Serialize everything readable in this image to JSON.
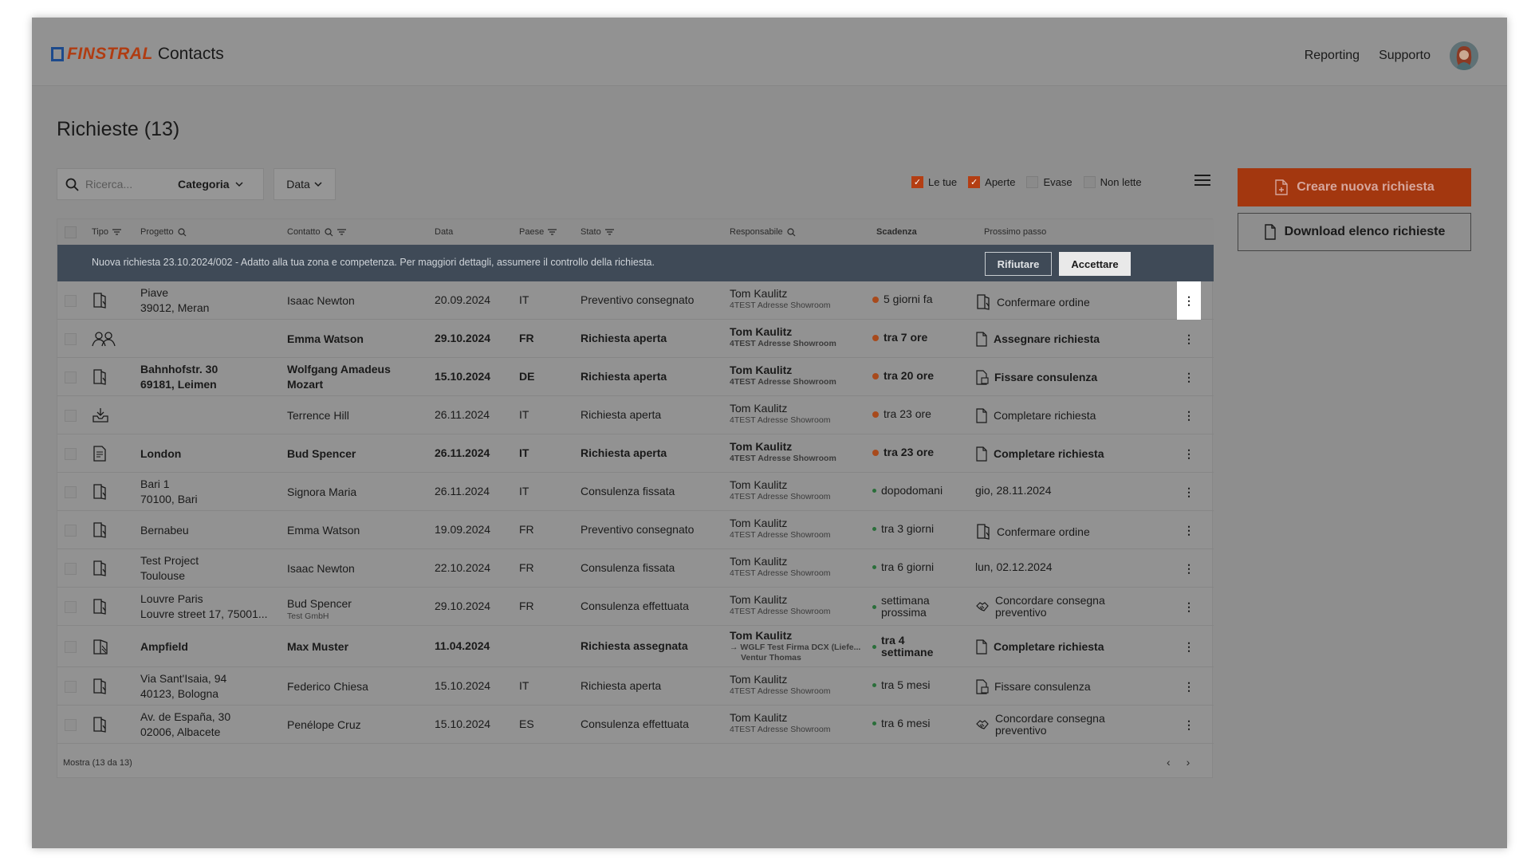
{
  "app": {
    "brand": "FINSTRAL",
    "name": "Contacts"
  },
  "nav": {
    "reporting": "Reporting",
    "support": "Supporto"
  },
  "page": {
    "title": "Richieste (13)"
  },
  "toolbar": {
    "search_placeholder": "Ricerca...",
    "category_label": "Categoria",
    "date_label": "Data",
    "filters": [
      {
        "label": "Le tue",
        "checked": true
      },
      {
        "label": "Aperte",
        "checked": true
      },
      {
        "label": "Evase",
        "checked": false
      },
      {
        "label": "Non lette",
        "checked": false
      }
    ],
    "new_request": "Creare nuova richiesta",
    "download_list": "Download elenco richieste"
  },
  "table": {
    "headers": {
      "type": "Tipo",
      "project": "Progetto",
      "contact": "Contatto",
      "date": "Data",
      "country": "Paese",
      "status": "Stato",
      "owner": "Responsabile",
      "due": "Scadenza",
      "next": "Prossimo passo"
    },
    "banner": {
      "message": "Nuova richiesta 23.10.2024/002 - Adatto alla tua zona e competenza. Per maggiori dettagli, assumere il controllo della richiesta.",
      "reject": "Rifiutare",
      "accept": "Accettare"
    },
    "rows": [
      {
        "icon": "door-icon",
        "project": [
          "Piave",
          "39012, Meran"
        ],
        "contact": "Isaac Newton",
        "contact_sub": "",
        "date": "20.09.2024",
        "country": "IT",
        "status": "Preventivo consegnato",
        "owner": "Tom Kaulitz",
        "owner_sub": "4TEST Adresse Showroom",
        "due": "5 giorni fa",
        "due_color": "orange",
        "next": "Confermare ordine",
        "next_icon": "door-icon",
        "bold": false
      },
      {
        "icon": "people-icon",
        "project": [
          "",
          ""
        ],
        "contact": "Emma Watson",
        "contact_sub": "",
        "date": "29.10.2024",
        "country": "FR",
        "status": "Richiesta aperta",
        "owner": "Tom Kaulitz",
        "owner_sub": "4TEST Adresse Showroom",
        "due": "tra 7 ore",
        "due_color": "orange",
        "next": "Assegnare richiesta",
        "next_icon": "document-icon",
        "bold": true
      },
      {
        "icon": "door-icon",
        "project": [
          "Bahnhofstr. 30",
          "69181, Leimen"
        ],
        "contact": "Wolfgang Amadeus Mozart",
        "contact_sub": "",
        "date": "15.10.2024",
        "country": "DE",
        "status": "Richiesta aperta",
        "owner": "Tom Kaulitz",
        "owner_sub": "4TEST Adresse Showroom",
        "due": "tra 20 ore",
        "due_color": "orange",
        "next": "Fissare consulenza",
        "next_icon": "calendar-doc-icon",
        "bold": true
      },
      {
        "icon": "inbox-icon",
        "project": [
          "",
          ""
        ],
        "contact": "Terrence Hill",
        "contact_sub": "",
        "date": "26.11.2024",
        "country": "IT",
        "status": "Richiesta aperta",
        "owner": "Tom Kaulitz",
        "owner_sub": "4TEST Adresse Showroom",
        "due": "tra 23 ore",
        "due_color": "orange",
        "next": "Completare richiesta",
        "next_icon": "document-icon",
        "bold": false
      },
      {
        "icon": "form-icon",
        "project": [
          "London",
          ""
        ],
        "contact": "Bud Spencer",
        "contact_sub": "",
        "date": "26.11.2024",
        "country": "IT",
        "status": "Richiesta aperta",
        "owner": "Tom Kaulitz",
        "owner_sub": "4TEST Adresse Showroom",
        "due": "tra 23 ore",
        "due_color": "orange",
        "next": "Completare richiesta",
        "next_icon": "document-icon",
        "bold": true
      },
      {
        "icon": "door-icon",
        "project": [
          "Bari 1",
          "70100, Bari"
        ],
        "contact": "Signora Maria",
        "contact_sub": "",
        "date": "26.11.2024",
        "country": "IT",
        "status": "Consulenza fissata",
        "owner": "Tom Kaulitz",
        "owner_sub": "4TEST Adresse Showroom",
        "due": "dopodomani",
        "due_color": "green",
        "next": "gio, 28.11.2024",
        "next_icon": "",
        "bold": false
      },
      {
        "icon": "door-icon",
        "project": [
          "Bernabeu",
          ""
        ],
        "contact": "Emma Watson",
        "contact_sub": "",
        "date": "19.09.2024",
        "country": "FR",
        "status": "Preventivo consegnato",
        "owner": "Tom Kaulitz",
        "owner_sub": "4TEST Adresse Showroom",
        "due": "tra 3 giorni",
        "due_color": "green",
        "next": "Confermare ordine",
        "next_icon": "door-icon",
        "bold": false
      },
      {
        "icon": "door-icon",
        "project": [
          "Test Project",
          "Toulouse"
        ],
        "contact": "Isaac Newton",
        "contact_sub": "",
        "date": "22.10.2024",
        "country": "FR",
        "status": "Consulenza fissata",
        "owner": "Tom Kaulitz",
        "owner_sub": "4TEST Adresse Showroom",
        "due": "tra 6 giorni",
        "due_color": "green",
        "next": "lun, 02.12.2024",
        "next_icon": "",
        "bold": false
      },
      {
        "icon": "door-icon",
        "project": [
          "Louvre Paris",
          "Louvre street 17, 75001..."
        ],
        "contact": "Bud Spencer",
        "contact_sub": "Test GmbH",
        "date": "29.10.2024",
        "country": "FR",
        "status": "Consulenza effettuata",
        "owner": "Tom Kaulitz",
        "owner_sub": "4TEST Adresse Showroom",
        "due": "settimana prossima",
        "due_color": "green",
        "next": "Concordare consegna preventivo",
        "next_icon": "handshake-icon",
        "bold": false
      },
      {
        "icon": "window-icon",
        "project": [
          "Ampfield",
          ""
        ],
        "contact": "Max Muster",
        "contact_sub": "",
        "date": "11.04.2024",
        "country": "",
        "status": "Richiesta assegnata",
        "owner": "Tom Kaulitz",
        "owner_sub": "→ WGLF Test Firma DCX (Liefe...",
        "owner_sub2": "Ventur Thomas",
        "due": "tra 4 settimane",
        "due_color": "green",
        "next": "Completare richiesta",
        "next_icon": "document-icon",
        "bold": true
      },
      {
        "icon": "door-icon",
        "project": [
          "Via Sant'Isaia, 94",
          "40123, Bologna"
        ],
        "contact": "Federico Chiesa",
        "contact_sub": "",
        "date": "15.10.2024",
        "country": "IT",
        "status": "Richiesta aperta",
        "owner": "Tom Kaulitz",
        "owner_sub": "4TEST Adresse Showroom",
        "due": "tra 5 mesi",
        "due_color": "green",
        "next": "Fissare consulenza",
        "next_icon": "calendar-doc-icon",
        "bold": false
      },
      {
        "icon": "door-icon",
        "project": [
          "Av. de España, 30",
          "02006, Albacete"
        ],
        "contact": "Penélope Cruz",
        "contact_sub": "",
        "date": "15.10.2024",
        "country": "ES",
        "status": "Consulenza effettuata",
        "owner": "Tom Kaulitz",
        "owner_sub": "4TEST Adresse Showroom",
        "due": "tra 6 mesi",
        "due_color": "green",
        "next": "Concordare consegna preventivo",
        "next_icon": "handshake-icon",
        "bold": false
      }
    ],
    "footer": {
      "showing": "Mostra  (13 da 13)",
      "prev": "‹",
      "next": "›"
    }
  }
}
